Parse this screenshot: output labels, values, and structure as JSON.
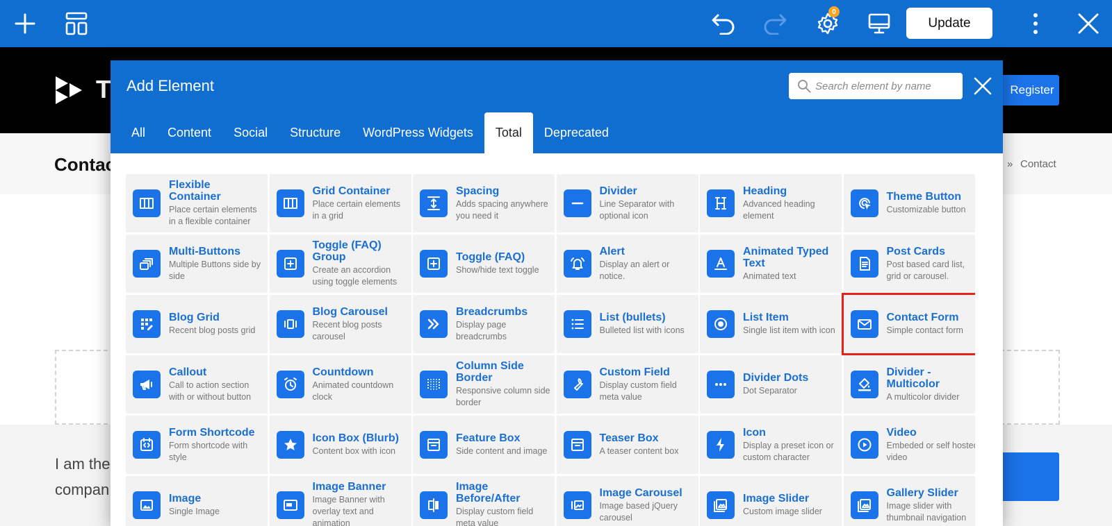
{
  "toolbar": {
    "update_label": "Update",
    "settings_badge": "0"
  },
  "site": {
    "logo_letter": "T",
    "register_label": "Register",
    "page_title": "Contac",
    "breadcrumb_sep": "»",
    "breadcrumb_current": "Contact",
    "text_line1": "I am the",
    "text_line2": "compan"
  },
  "modal": {
    "title": "Add Element",
    "search_placeholder": "Search element by name",
    "tabs": [
      {
        "label": "All"
      },
      {
        "label": "Content"
      },
      {
        "label": "Social"
      },
      {
        "label": "Structure"
      },
      {
        "label": "WordPress Widgets"
      },
      {
        "label": "Total"
      },
      {
        "label": "Deprecated"
      }
    ],
    "active_tab": "Total",
    "elements": [
      {
        "title": "Flexible Container",
        "desc": "Place certain elements in a flexible container",
        "icon": "flex-container-icon"
      },
      {
        "title": "Grid Container",
        "desc": "Place certain elements in a grid",
        "icon": "grid-container-icon"
      },
      {
        "title": "Spacing",
        "desc": "Adds spacing anywhere you need it",
        "icon": "spacing-icon"
      },
      {
        "title": "Divider",
        "desc": "Line Separator with optional icon",
        "icon": "divider-icon"
      },
      {
        "title": "Heading",
        "desc": "Advanced heading element",
        "icon": "heading-icon"
      },
      {
        "title": "Theme Button",
        "desc": "Customizable button",
        "icon": "theme-button-icon"
      },
      {
        "title": "Multi-Buttons",
        "desc": "Multiple Buttons side by side",
        "icon": "multi-buttons-icon"
      },
      {
        "title": "Toggle (FAQ) Group",
        "desc": "Create an accordion using toggle elements",
        "icon": "toggle-group-icon"
      },
      {
        "title": "Toggle (FAQ)",
        "desc": "Show/hide text toggle",
        "icon": "toggle-icon"
      },
      {
        "title": "Alert",
        "desc": "Display an alert or notice.",
        "icon": "alert-bell-icon"
      },
      {
        "title": "Animated Typed Text",
        "desc": "Animated text",
        "icon": "animated-text-icon"
      },
      {
        "title": "Post Cards",
        "desc": "Post based card list, grid or carousel.",
        "icon": "post-cards-icon"
      },
      {
        "title": "Blog Grid",
        "desc": "Recent blog posts grid",
        "icon": "blog-grid-icon"
      },
      {
        "title": "Blog Carousel",
        "desc": "Recent blog posts carousel",
        "icon": "blog-carousel-icon"
      },
      {
        "title": "Breadcrumbs",
        "desc": "Display page breadcrumbs",
        "icon": "breadcrumbs-icon"
      },
      {
        "title": "List (bullets)",
        "desc": "Bulleted list with icons",
        "icon": "list-bullets-icon"
      },
      {
        "title": "List Item",
        "desc": "Single list item with icon",
        "icon": "list-item-icon"
      },
      {
        "title": "Contact Form",
        "desc": "Simple contact form",
        "icon": "envelope-icon"
      },
      {
        "title": "Callout",
        "desc": "Call to action section with or without button",
        "icon": "megaphone-icon"
      },
      {
        "title": "Countdown",
        "desc": "Animated countdown clock",
        "icon": "alarm-clock-icon"
      },
      {
        "title": "Column Side Border",
        "desc": "Responsive column side border",
        "icon": "column-border-icon"
      },
      {
        "title": "Custom Field",
        "desc": "Display custom field meta value",
        "icon": "wrench-icon"
      },
      {
        "title": "Divider Dots",
        "desc": "Dot Separator",
        "icon": "dots-icon"
      },
      {
        "title": "Divider - Multicolor",
        "desc": "A multicolor divider",
        "icon": "paint-bucket-icon"
      },
      {
        "title": "Form Shortcode",
        "desc": "Form shortcode with style",
        "icon": "shortcode-icon"
      },
      {
        "title": "Icon Box (Blurb)",
        "desc": "Content box with icon",
        "icon": "star-icon"
      },
      {
        "title": "Feature Box",
        "desc": "Side content and image",
        "icon": "feature-box-icon"
      },
      {
        "title": "Teaser Box",
        "desc": "A teaser content box",
        "icon": "teaser-box-icon"
      },
      {
        "title": "Icon",
        "desc": "Display a preset icon or custom character",
        "icon": "bolt-icon"
      },
      {
        "title": "Video",
        "desc": "Embeded or self hosted video",
        "icon": "play-icon"
      },
      {
        "title": "Image",
        "desc": "Single Image",
        "icon": "image-icon"
      },
      {
        "title": "Image Banner",
        "desc": "Image Banner with overlay text and animation",
        "icon": "image-banner-icon"
      },
      {
        "title": "Image Before/After",
        "desc": "Display custom field meta value",
        "icon": "before-after-icon"
      },
      {
        "title": "Image Carousel",
        "desc": "Image based jQuery carousel",
        "icon": "image-carousel-icon"
      },
      {
        "title": "Image Slider",
        "desc": "Custom image slider",
        "icon": "image-slider-icon"
      },
      {
        "title": "Gallery Slider",
        "desc": "Image slider with thumbnail navigation",
        "icon": "gallery-slider-icon"
      }
    ],
    "highlighted_element": "Contact Form"
  },
  "colors": {
    "toolbar_blue": "#0f6ed0",
    "element_title": "#1a6fd0",
    "icon_tile": "#1a73e8",
    "highlight_red": "#e5221a",
    "badge_orange": "#f5a623"
  }
}
